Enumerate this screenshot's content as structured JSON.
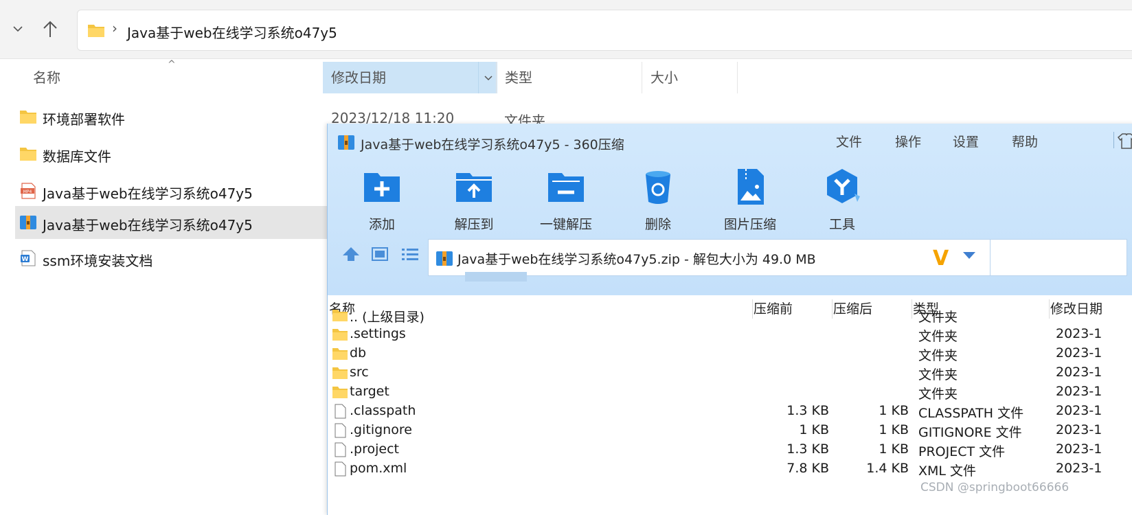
{
  "explorer": {
    "address": "Java基于web在线学习系统o47y5",
    "columns": {
      "name": "名称",
      "date": "修改日期",
      "type": "类型",
      "size": "大小"
    },
    "files": [
      {
        "name": "环境部署软件",
        "icon": "folder-icon"
      },
      {
        "name": "数据库文件",
        "icon": "folder-icon"
      },
      {
        "name": "Java基于web在线学习系统o47y5",
        "icon": "mp4-file-icon"
      },
      {
        "name": "Java基于web在线学习系统o47y5",
        "icon": "zip-archive-icon"
      },
      {
        "name": "ssm环境安装文档",
        "icon": "word-document-icon"
      }
    ],
    "first_row_date": "2023/12/18 11:20",
    "first_row_type": "文件夹"
  },
  "zip": {
    "title": "Java基于web在线学习系统o47y5 - 360压缩",
    "menu": [
      "文件",
      "操作",
      "设置",
      "帮助"
    ],
    "toolbar": [
      {
        "label": "添加",
        "icon": "add-icon"
      },
      {
        "label": "解压到",
        "icon": "extract-to-icon"
      },
      {
        "label": "一键解压",
        "icon": "one-click-extract-icon"
      },
      {
        "label": "删除",
        "icon": "delete-icon"
      },
      {
        "label": "图片压缩",
        "icon": "image-compress-icon"
      },
      {
        "label": "工具",
        "icon": "tools-icon"
      }
    ],
    "path": "Java基于web在线学习系统o47y5.zip - 解包大小为 49.0 MB",
    "columns": {
      "name": "名称",
      "before": "压缩前",
      "after": "压缩后",
      "type": "类型",
      "date": "修改日期"
    },
    "rows": [
      {
        "name": ".. (上级目录)",
        "before": "",
        "after": "",
        "type": "文件夹",
        "date": "",
        "icon": "folder-icon"
      },
      {
        "name": ".settings",
        "before": "",
        "after": "",
        "type": "文件夹",
        "date": "2023-1",
        "icon": "folder-icon"
      },
      {
        "name": "db",
        "before": "",
        "after": "",
        "type": "文件夹",
        "date": "2023-1",
        "icon": "folder-icon"
      },
      {
        "name": "src",
        "before": "",
        "after": "",
        "type": "文件夹",
        "date": "2023-1",
        "icon": "folder-icon"
      },
      {
        "name": "target",
        "before": "",
        "after": "",
        "type": "文件夹",
        "date": "2023-1",
        "icon": "folder-icon"
      },
      {
        "name": ".classpath",
        "before": "1.3 KB",
        "after": "1 KB",
        "type": "CLASSPATH 文件",
        "date": "2023-1",
        "icon": "file-icon"
      },
      {
        "name": ".gitignore",
        "before": "1 KB",
        "after": "1 KB",
        "type": "GITIGNORE 文件",
        "date": "2023-1",
        "icon": "file-icon"
      },
      {
        "name": ".project",
        "before": "1.3 KB",
        "after": "1 KB",
        "type": "PROJECT 文件",
        "date": "2023-1",
        "icon": "file-icon"
      },
      {
        "name": "pom.xml",
        "before": "7.8 KB",
        "after": "1.4 KB",
        "type": "XML 文件",
        "date": "2023-1",
        "icon": "file-icon"
      }
    ]
  },
  "watermark": "CSDN @springboot66666",
  "colors": {
    "folder": "#f4c542",
    "zip_blue": "#2f8be0",
    "accent": "#cce4f7"
  }
}
